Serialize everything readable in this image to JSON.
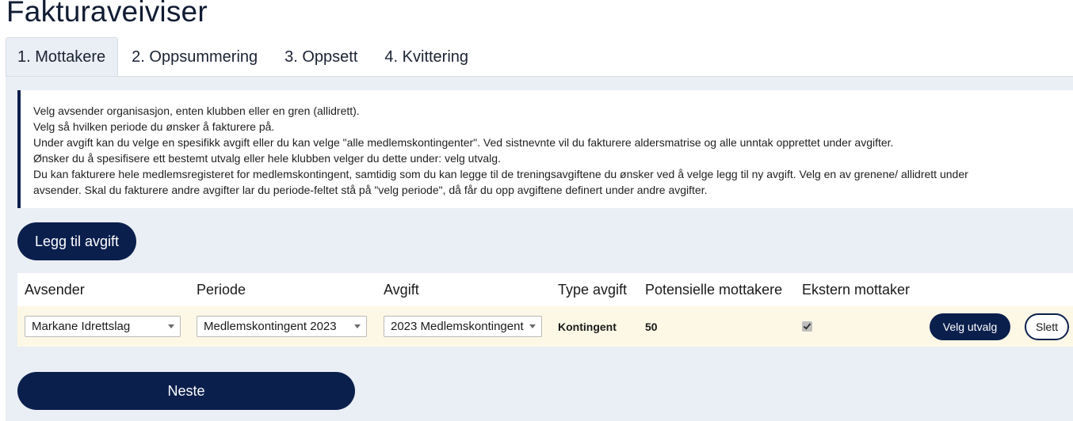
{
  "page": {
    "title": "Fakturaveiviser"
  },
  "tabs": [
    {
      "label": "1. Mottakere",
      "active": true
    },
    {
      "label": "2. Oppsummering",
      "active": false
    },
    {
      "label": "3. Oppsett",
      "active": false
    },
    {
      "label": "4. Kvittering",
      "active": false
    }
  ],
  "info": {
    "lines": [
      "Velg avsender organisasjon, enten klubben eller en gren (allidrett).",
      "Velg så hvilken periode du ønsker å fakturere på.",
      "Under avgift kan du velge en spesifikk avgift eller du kan velge \"alle medlemskontingenter\". Ved sistnevnte vil du fakturere aldersmatrise og alle unntak opprettet under avgifter.",
      "Ønsker du å spesifisere ett bestemt utvalg eller hele klubben velger du dette under: velg utvalg.",
      "Du kan fakturere hele medlemsregisteret for medlemskontingent, samtidig som du kan legge til de treningsavgiftene du ønsker ved å velge legg til ny avgift. Velg en av grenene/ allidrett under",
      "avsender. Skal du fakturere andre avgifter lar du periode-feltet stå på \"velg periode\", då får du opp avgiftene definert under andre avgifter."
    ]
  },
  "actions": {
    "add_fee_label": "Legg til avgift",
    "next_label": "Neste"
  },
  "fee_table": {
    "headers": {
      "sender": "Avsender",
      "period": "Periode",
      "fee": "Avgift",
      "fee_type": "Type avgift",
      "potential_recipients": "Potensielle mottakere",
      "external_recipient": "Ekstern mottaker"
    },
    "rows": [
      {
        "sender": "Markane Idrettslag",
        "period": "Medlemskontingent 2023",
        "fee": "2023 Medlemskontingent",
        "fee_type": "Kontingent",
        "potential_recipients": "50",
        "external_recipient": true,
        "select_label": "Velg utvalg",
        "delete_label": "Slett"
      }
    ]
  },
  "colors": {
    "primary": "#0b1f4d",
    "panel_bg": "#e9eff4",
    "row_bg": "#fdf8e6"
  },
  "icons": [
    "chevron-down-icon",
    "checkmark-icon"
  ]
}
